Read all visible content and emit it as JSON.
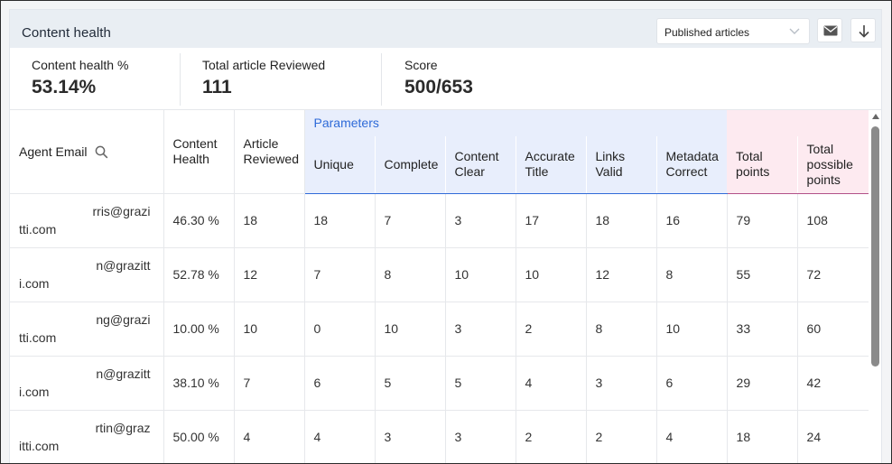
{
  "header": {
    "title": "Content health",
    "filter": {
      "selected": "Published articles"
    },
    "actions": {
      "email_icon": "mail-icon",
      "download_icon": "arrow-down-icon"
    }
  },
  "stats": [
    {
      "label": "Content health %",
      "value": "53.14%"
    },
    {
      "label": "Total article Reviewed",
      "value": "111"
    },
    {
      "label": "Score",
      "value": "500/653"
    }
  ],
  "table": {
    "group_parameters": "Parameters",
    "columns": {
      "agent_email": "Agent Email",
      "content_health": [
        "Content",
        "Health"
      ],
      "article_reviewed": [
        "Article",
        "Reviewed"
      ],
      "unique": "Unique",
      "complete": "Complete",
      "content_clear": [
        "Content",
        "Clear"
      ],
      "accurate_title": [
        "Accurate",
        "Title"
      ],
      "links_valid": [
        "Links",
        "Valid"
      ],
      "metadata_correct": [
        "Metadata",
        "Correct"
      ],
      "total_points": [
        "Total",
        "points"
      ],
      "total_possible_points": [
        "Total",
        "possible",
        "points"
      ]
    },
    "rows": [
      {
        "email": [
          "rris@grazi",
          "tti.com"
        ],
        "health": "46.30 %",
        "reviewed": "18",
        "unique": "18",
        "complete": "7",
        "clear": "3",
        "title": "17",
        "links": "18",
        "metadata": "16",
        "points": "79",
        "possible": "108"
      },
      {
        "email": [
          "n@grazitt",
          "i.com"
        ],
        "health": "52.78 %",
        "reviewed": "12",
        "unique": "7",
        "complete": "8",
        "clear": "10",
        "title": "10",
        "links": "12",
        "metadata": "8",
        "points": "55",
        "possible": "72"
      },
      {
        "email": [
          "ng@grazi",
          "tti.com"
        ],
        "health": "10.00 %",
        "reviewed": "10",
        "unique": "0",
        "complete": "10",
        "clear": "3",
        "title": "2",
        "links": "8",
        "metadata": "10",
        "points": "33",
        "possible": "60"
      },
      {
        "email": [
          "n@grazitt",
          "i.com"
        ],
        "health": "38.10 %",
        "reviewed": "7",
        "unique": "6",
        "complete": "5",
        "clear": "5",
        "title": "4",
        "links": "3",
        "metadata": "6",
        "points": "29",
        "possible": "42"
      },
      {
        "email": [
          "rtin@graz",
          "itti.com"
        ],
        "health": "50.00 %",
        "reviewed": "4",
        "unique": "4",
        "complete": "3",
        "clear": "3",
        "title": "2",
        "links": "2",
        "metadata": "4",
        "points": "18",
        "possible": "24"
      }
    ]
  },
  "colors": {
    "header_bg": "#e9eef3",
    "parameters_bg": "#e8eefc",
    "parameters_text": "#2f6bd8",
    "points_bg": "#fdeaf0",
    "points_underline": "#b25188"
  }
}
